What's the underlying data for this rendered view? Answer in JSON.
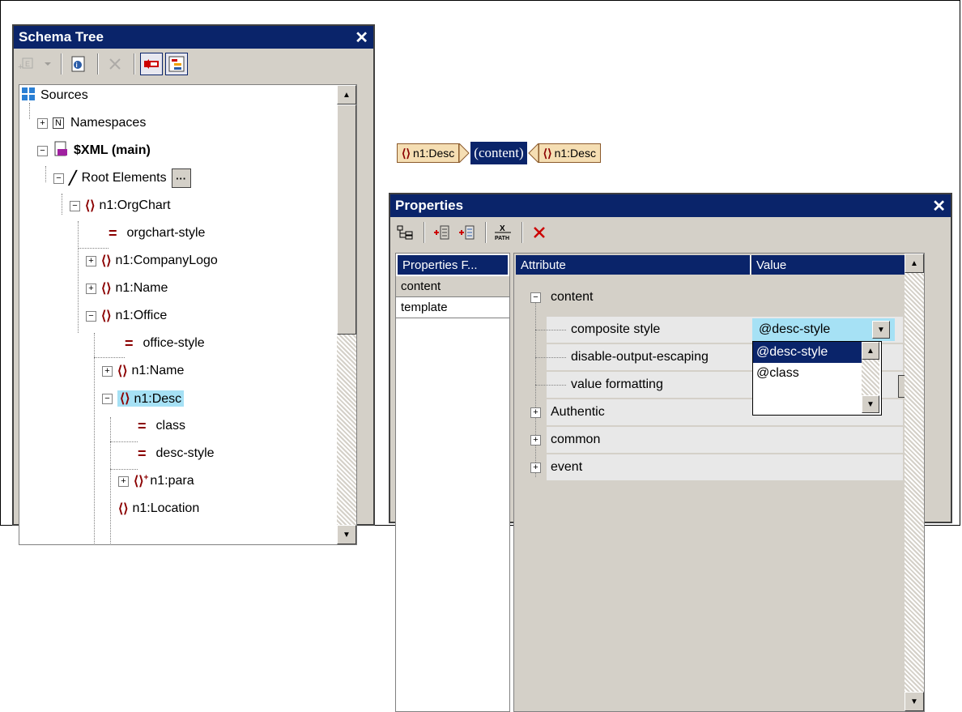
{
  "schema_tree": {
    "title": "Schema Tree",
    "nodes": {
      "sources": "Sources",
      "namespaces": "Namespaces",
      "xml_main": "$XML (main)",
      "root_elements": "Root Elements",
      "orgchart": "n1:OrgChart",
      "orgchart_style": "orgchart-style",
      "company_logo": "n1:CompanyLogo",
      "name1": "n1:Name",
      "office": "n1:Office",
      "office_style": "office-style",
      "name2": "n1:Name",
      "desc": "n1:Desc",
      "class_attr": "class",
      "desc_style": "desc-style",
      "para": "n1:para",
      "location": "n1:Location"
    }
  },
  "tag_bar": {
    "start_tag": "n1:Desc",
    "content": "(content)",
    "end_tag": "n1:Desc"
  },
  "properties": {
    "title": "Properties",
    "list_header": "Properties F...",
    "list_items": [
      "content",
      "template"
    ],
    "col_attribute": "Attribute",
    "col_value": "Value",
    "rows": {
      "content_group": "content",
      "composite_style": "composite style",
      "composite_style_value": "@desc-style",
      "disable_output": "disable-output-escaping",
      "value_formatting": "value formatting",
      "authentic": "Authentic",
      "common": "common",
      "event": "event"
    },
    "dropdown_options": [
      "@desc-style",
      "@class"
    ]
  },
  "colors": {
    "title_bar": "#0a246a",
    "selection": "#a6e1f5",
    "element_icon": "#8b0000",
    "tag_fill": "#f5deb3"
  }
}
